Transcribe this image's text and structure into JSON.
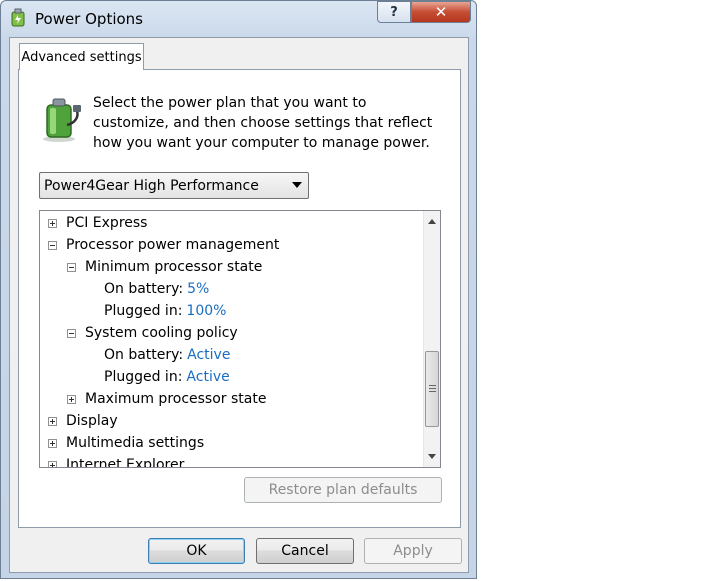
{
  "window": {
    "title": "Power Options",
    "help_glyph": "?",
    "close_glyph": "✕"
  },
  "tab": {
    "label": "Advanced settings"
  },
  "intro": {
    "text": "Select the power plan that you want to customize, and then choose settings that reflect how you want your computer to manage power."
  },
  "plan": {
    "selected": "Power4Gear High Performance"
  },
  "tree": {
    "items": [
      {
        "label": "PCI Express",
        "expander": "plus",
        "value": ""
      },
      {
        "label": "Processor power management",
        "expander": "minus",
        "value": ""
      },
      {
        "label": "Minimum processor state",
        "expander": "minus",
        "value": ""
      },
      {
        "label": "On battery:",
        "expander": "",
        "value": "5%"
      },
      {
        "label": "Plugged in:",
        "expander": "",
        "value": "100%"
      },
      {
        "label": "System cooling policy",
        "expander": "minus",
        "value": ""
      },
      {
        "label": "On battery:",
        "expander": "",
        "value": "Active"
      },
      {
        "label": "Plugged in:",
        "expander": "",
        "value": "Active"
      },
      {
        "label": "Maximum processor state",
        "expander": "plus",
        "value": ""
      },
      {
        "label": "Display",
        "expander": "plus",
        "value": ""
      },
      {
        "label": "Multimedia settings",
        "expander": "plus",
        "value": ""
      },
      {
        "label": "Internet Explorer",
        "expander": "plus",
        "value": ""
      }
    ]
  },
  "buttons": {
    "restore": "Restore plan defaults",
    "ok": "OK",
    "cancel": "Cancel",
    "apply": "Apply"
  },
  "colors": {
    "value_link": "#1a6dc1",
    "close_red": "#c74d35"
  }
}
